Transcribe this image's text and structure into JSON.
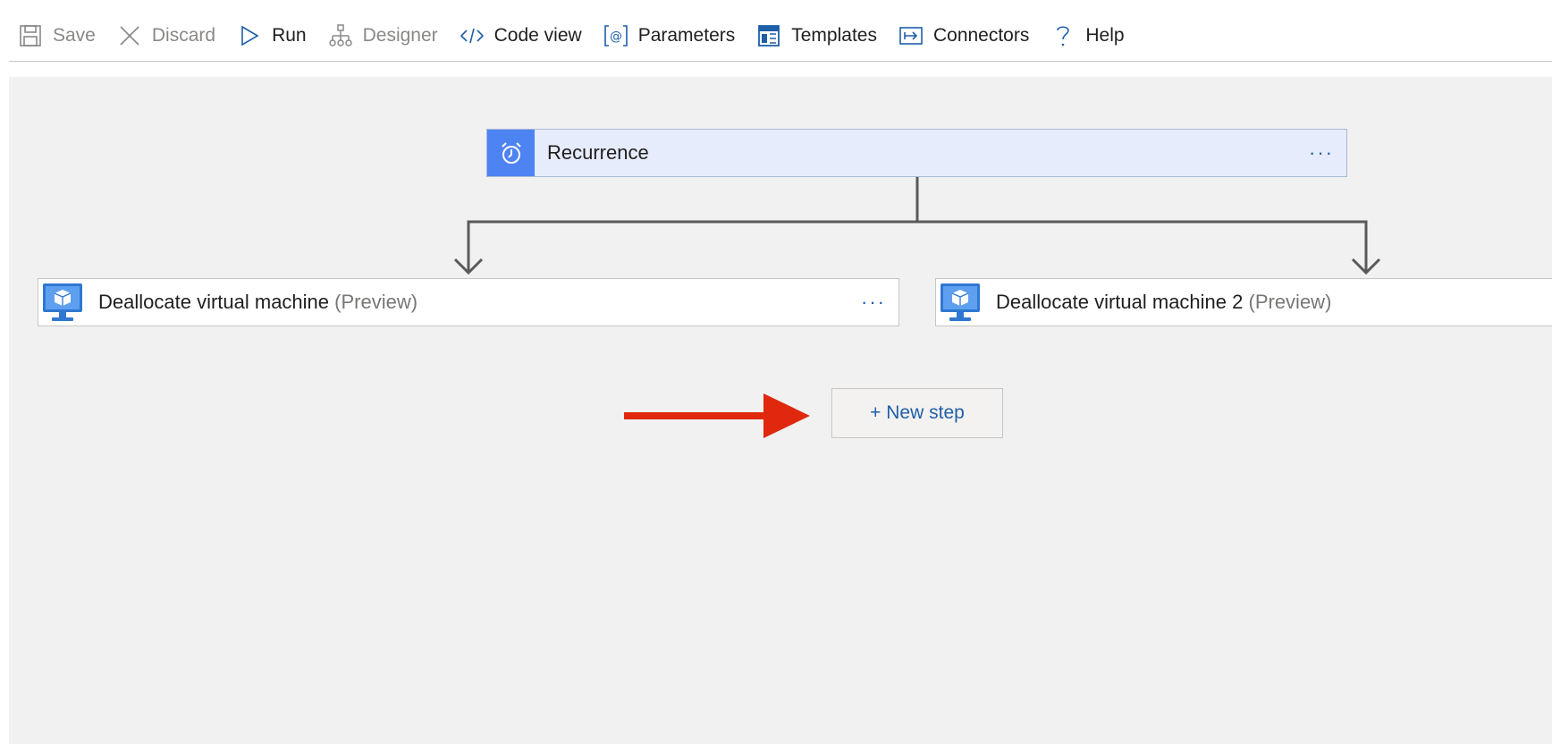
{
  "toolbar": {
    "save": "Save",
    "discard": "Discard",
    "run": "Run",
    "designer": "Designer",
    "code_view": "Code view",
    "parameters": "Parameters",
    "templates": "Templates",
    "connectors": "Connectors",
    "help": "Help"
  },
  "flow": {
    "trigger": {
      "title": "Recurrence",
      "menu": "···",
      "icon": "alarm-clock-icon"
    },
    "branches": [
      {
        "title": "Deallocate virtual machine",
        "suffix": "(Preview)",
        "menu": "···",
        "icon": "virtual-machine-icon"
      },
      {
        "title": "Deallocate virtual machine 2",
        "suffix": "(Preview)",
        "icon": "virtual-machine-icon"
      }
    ],
    "new_step": "+ New step"
  },
  "colors": {
    "accent": "#1f5fa8",
    "trigger_icon_bg": "#4e83f3",
    "arrow": "#e0280f",
    "canvas": "#f1f1f1"
  }
}
